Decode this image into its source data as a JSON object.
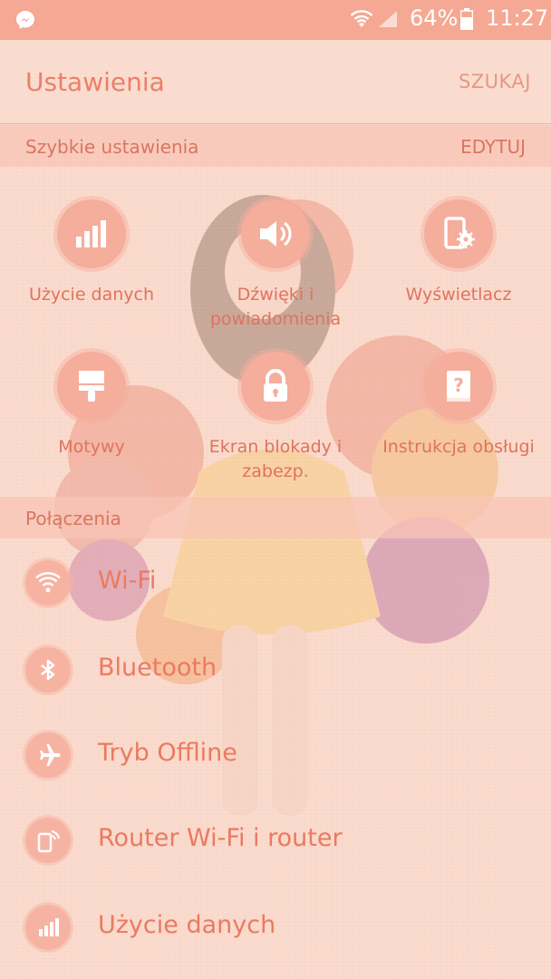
{
  "status_bar": {
    "battery_percent": "64%",
    "time": "11:27",
    "icons": [
      "messenger-icon",
      "wifi-icon",
      "signal-icon",
      "battery-icon"
    ]
  },
  "app_bar": {
    "title": "Ustawienia",
    "search_label": "SZUKAJ"
  },
  "quick_settings": {
    "title": "Szybkie ustawienia",
    "edit_label": "EDYTUJ",
    "items": [
      {
        "label": "Użycie danych",
        "icon": "data-usage-icon"
      },
      {
        "label": "Dźwięki i powiadomienia",
        "icon": "speaker-icon"
      },
      {
        "label": "Wyświetlacz",
        "icon": "display-settings-icon"
      },
      {
        "label": "Motywy",
        "icon": "paintbrush-icon"
      },
      {
        "label": "Ekran blokady i zabezp.",
        "icon": "lock-icon"
      },
      {
        "label": "Instrukcja obsługi",
        "icon": "manual-icon"
      }
    ]
  },
  "connections": {
    "title": "Połączenia",
    "items": [
      {
        "label": "Wi-Fi",
        "icon": "wifi-icon"
      },
      {
        "label": "Bluetooth",
        "icon": "bluetooth-icon"
      },
      {
        "label": "Tryb Offline",
        "icon": "airplane-icon"
      },
      {
        "label": "Router Wi-Fi i router",
        "icon": "hotspot-icon"
      },
      {
        "label": "Użycie danych",
        "icon": "data-usage-icon"
      }
    ]
  },
  "colors": {
    "accent": "#ec7f66",
    "status_bar": "#f5a893",
    "background": "#f9d9cb",
    "icon_circle": "#f5ad9c"
  }
}
